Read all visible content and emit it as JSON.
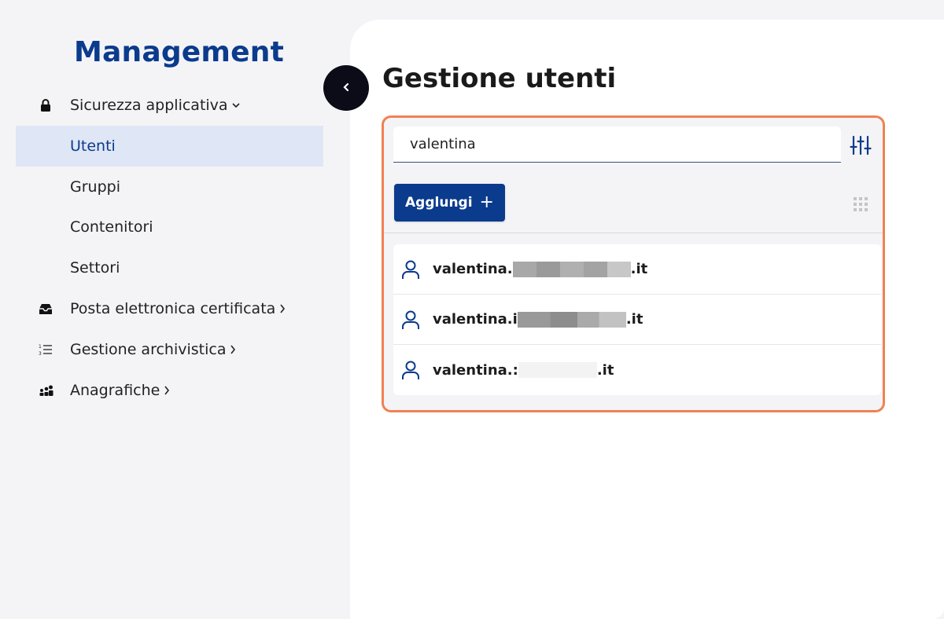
{
  "brand": "Management",
  "sidebar": {
    "items": [
      {
        "label": "Sicurezza applicativa",
        "icon": "lock-icon",
        "chevron": "down"
      },
      {
        "label": "Utenti",
        "active": true
      },
      {
        "label": "Gruppi"
      },
      {
        "label": "Contenitori"
      },
      {
        "label": "Settori"
      },
      {
        "label": "Posta elettronica certificata",
        "icon": "inbox-icon",
        "chevron": "right"
      },
      {
        "label": "Gestione archivistica",
        "icon": "list-icon",
        "chevron": "right"
      },
      {
        "label": "Anagrafiche",
        "icon": "people-icon",
        "chevron": "right"
      }
    ]
  },
  "main": {
    "title": "Gestione utenti",
    "search": {
      "value": "valentina"
    },
    "add_button": {
      "label": "Agglungi",
      "icon": "plus-icon"
    },
    "results": [
      {
        "prefix": "valentina.",
        "suffix": ".it"
      },
      {
        "prefix": "valentina.i",
        "suffix": ".it"
      },
      {
        "prefix": "valentina.:",
        "suffix": ".it"
      }
    ]
  },
  "colors": {
    "brand": "#0b3b8c",
    "active_bg": "#dfe6f5",
    "highlight": "#f08152",
    "dark_button": "#0c0c18"
  }
}
